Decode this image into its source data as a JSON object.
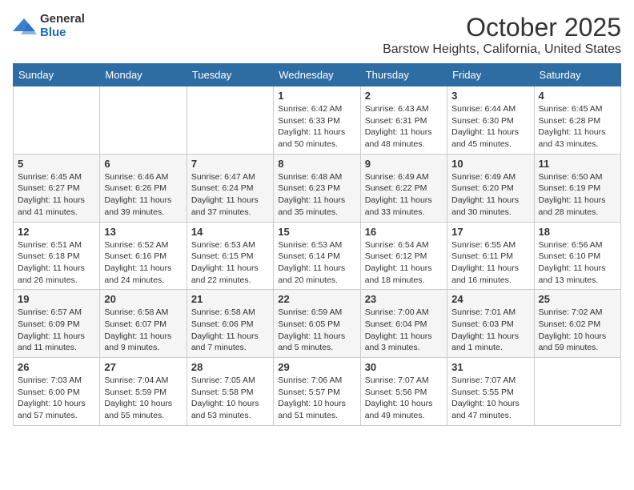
{
  "logo": {
    "general": "General",
    "blue": "Blue"
  },
  "title": "October 2025",
  "location": "Barstow Heights, California, United States",
  "days_of_week": [
    "Sunday",
    "Monday",
    "Tuesday",
    "Wednesday",
    "Thursday",
    "Friday",
    "Saturday"
  ],
  "weeks": [
    [
      {
        "day": "",
        "info": ""
      },
      {
        "day": "",
        "info": ""
      },
      {
        "day": "",
        "info": ""
      },
      {
        "day": "1",
        "info": "Sunrise: 6:42 AM\nSunset: 6:33 PM\nDaylight: 11 hours\nand 50 minutes."
      },
      {
        "day": "2",
        "info": "Sunrise: 6:43 AM\nSunset: 6:31 PM\nDaylight: 11 hours\nand 48 minutes."
      },
      {
        "day": "3",
        "info": "Sunrise: 6:44 AM\nSunset: 6:30 PM\nDaylight: 11 hours\nand 45 minutes."
      },
      {
        "day": "4",
        "info": "Sunrise: 6:45 AM\nSunset: 6:28 PM\nDaylight: 11 hours\nand 43 minutes."
      }
    ],
    [
      {
        "day": "5",
        "info": "Sunrise: 6:45 AM\nSunset: 6:27 PM\nDaylight: 11 hours\nand 41 minutes."
      },
      {
        "day": "6",
        "info": "Sunrise: 6:46 AM\nSunset: 6:26 PM\nDaylight: 11 hours\nand 39 minutes."
      },
      {
        "day": "7",
        "info": "Sunrise: 6:47 AM\nSunset: 6:24 PM\nDaylight: 11 hours\nand 37 minutes."
      },
      {
        "day": "8",
        "info": "Sunrise: 6:48 AM\nSunset: 6:23 PM\nDaylight: 11 hours\nand 35 minutes."
      },
      {
        "day": "9",
        "info": "Sunrise: 6:49 AM\nSunset: 6:22 PM\nDaylight: 11 hours\nand 33 minutes."
      },
      {
        "day": "10",
        "info": "Sunrise: 6:49 AM\nSunset: 6:20 PM\nDaylight: 11 hours\nand 30 minutes."
      },
      {
        "day": "11",
        "info": "Sunrise: 6:50 AM\nSunset: 6:19 PM\nDaylight: 11 hours\nand 28 minutes."
      }
    ],
    [
      {
        "day": "12",
        "info": "Sunrise: 6:51 AM\nSunset: 6:18 PM\nDaylight: 11 hours\nand 26 minutes."
      },
      {
        "day": "13",
        "info": "Sunrise: 6:52 AM\nSunset: 6:16 PM\nDaylight: 11 hours\nand 24 minutes."
      },
      {
        "day": "14",
        "info": "Sunrise: 6:53 AM\nSunset: 6:15 PM\nDaylight: 11 hours\nand 22 minutes."
      },
      {
        "day": "15",
        "info": "Sunrise: 6:53 AM\nSunset: 6:14 PM\nDaylight: 11 hours\nand 20 minutes."
      },
      {
        "day": "16",
        "info": "Sunrise: 6:54 AM\nSunset: 6:12 PM\nDaylight: 11 hours\nand 18 minutes."
      },
      {
        "day": "17",
        "info": "Sunrise: 6:55 AM\nSunset: 6:11 PM\nDaylight: 11 hours\nand 16 minutes."
      },
      {
        "day": "18",
        "info": "Sunrise: 6:56 AM\nSunset: 6:10 PM\nDaylight: 11 hours\nand 13 minutes."
      }
    ],
    [
      {
        "day": "19",
        "info": "Sunrise: 6:57 AM\nSunset: 6:09 PM\nDaylight: 11 hours\nand 11 minutes."
      },
      {
        "day": "20",
        "info": "Sunrise: 6:58 AM\nSunset: 6:07 PM\nDaylight: 11 hours\nand 9 minutes."
      },
      {
        "day": "21",
        "info": "Sunrise: 6:58 AM\nSunset: 6:06 PM\nDaylight: 11 hours\nand 7 minutes."
      },
      {
        "day": "22",
        "info": "Sunrise: 6:59 AM\nSunset: 6:05 PM\nDaylight: 11 hours\nand 5 minutes."
      },
      {
        "day": "23",
        "info": "Sunrise: 7:00 AM\nSunset: 6:04 PM\nDaylight: 11 hours\nand 3 minutes."
      },
      {
        "day": "24",
        "info": "Sunrise: 7:01 AM\nSunset: 6:03 PM\nDaylight: 11 hours\nand 1 minute."
      },
      {
        "day": "25",
        "info": "Sunrise: 7:02 AM\nSunset: 6:02 PM\nDaylight: 10 hours\nand 59 minutes."
      }
    ],
    [
      {
        "day": "26",
        "info": "Sunrise: 7:03 AM\nSunset: 6:00 PM\nDaylight: 10 hours\nand 57 minutes."
      },
      {
        "day": "27",
        "info": "Sunrise: 7:04 AM\nSunset: 5:59 PM\nDaylight: 10 hours\nand 55 minutes."
      },
      {
        "day": "28",
        "info": "Sunrise: 7:05 AM\nSunset: 5:58 PM\nDaylight: 10 hours\nand 53 minutes."
      },
      {
        "day": "29",
        "info": "Sunrise: 7:06 AM\nSunset: 5:57 PM\nDaylight: 10 hours\nand 51 minutes."
      },
      {
        "day": "30",
        "info": "Sunrise: 7:07 AM\nSunset: 5:56 PM\nDaylight: 10 hours\nand 49 minutes."
      },
      {
        "day": "31",
        "info": "Sunrise: 7:07 AM\nSunset: 5:55 PM\nDaylight: 10 hours\nand 47 minutes."
      },
      {
        "day": "",
        "info": ""
      }
    ]
  ]
}
